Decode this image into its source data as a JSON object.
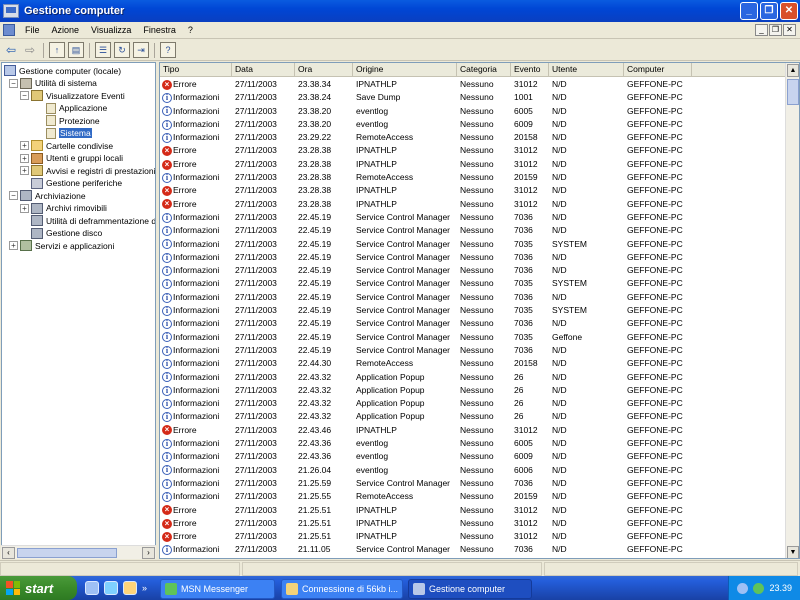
{
  "window": {
    "title": "Gestione computer",
    "controls": [
      "_",
      "❐",
      "✕"
    ]
  },
  "menu": {
    "items": [
      "File",
      "Azione",
      "Visualizza",
      "Finestra",
      "?"
    ],
    "mdi_controls": [
      "_",
      "❐",
      "✕"
    ]
  },
  "tree": {
    "nodes": [
      {
        "label": "Gestione computer (locale)",
        "level": 0,
        "expander": "",
        "icon": "computer-icon"
      },
      {
        "label": "Utilità di sistema",
        "level": 1,
        "expander": "−",
        "icon": "tools-icon"
      },
      {
        "label": "Visualizzatore Eventi",
        "level": 2,
        "expander": "−",
        "icon": "event-viewer-icon"
      },
      {
        "label": "Applicazione",
        "level": 3,
        "expander": "",
        "icon": "log-icon"
      },
      {
        "label": "Protezione",
        "level": 3,
        "expander": "",
        "icon": "log-icon"
      },
      {
        "label": "Sistema",
        "level": 3,
        "expander": "",
        "icon": "log-icon",
        "selected": true
      },
      {
        "label": "Cartelle condivise",
        "level": 2,
        "expander": "+",
        "icon": "folder-icon"
      },
      {
        "label": "Utenti e gruppi locali",
        "level": 2,
        "expander": "+",
        "icon": "users-icon"
      },
      {
        "label": "Avvisi e registri di prestazioni",
        "level": 2,
        "expander": "+",
        "icon": "performance-icon"
      },
      {
        "label": "Gestione periferiche",
        "level": 2,
        "expander": "",
        "icon": "device-icon"
      },
      {
        "label": "Archiviazione",
        "level": 1,
        "expander": "−",
        "icon": "storage-icon"
      },
      {
        "label": "Archivi rimovibili",
        "level": 2,
        "expander": "+",
        "icon": "removable-icon"
      },
      {
        "label": "Utilità di deframmentazione dischi",
        "level": 2,
        "expander": "",
        "icon": "defrag-icon"
      },
      {
        "label": "Gestione disco",
        "level": 2,
        "expander": "",
        "icon": "disk-icon"
      },
      {
        "label": "Servizi e applicazioni",
        "level": 1,
        "expander": "+",
        "icon": "services-icon"
      }
    ]
  },
  "table": {
    "columns": [
      "Tipo",
      "Data",
      "Ora",
      "Origine",
      "Categoria",
      "Evento",
      "Utente",
      "Computer"
    ],
    "rows": [
      [
        "Errore",
        "27/11/2003",
        "23.38.34",
        "IPNATHLP",
        "Nessuno",
        "31012",
        "N/D",
        "GEFFONE-PC"
      ],
      [
        "Informazioni",
        "27/11/2003",
        "23.38.24",
        "Save Dump",
        "Nessuno",
        "1001",
        "N/D",
        "GEFFONE-PC"
      ],
      [
        "Informazioni",
        "27/11/2003",
        "23.38.20",
        "eventlog",
        "Nessuno",
        "6005",
        "N/D",
        "GEFFONE-PC"
      ],
      [
        "Informazioni",
        "27/11/2003",
        "23.38.20",
        "eventlog",
        "Nessuno",
        "6009",
        "N/D",
        "GEFFONE-PC"
      ],
      [
        "Informazioni",
        "27/11/2003",
        "23.29.22",
        "RemoteAccess",
        "Nessuno",
        "20158",
        "N/D",
        "GEFFONE-PC"
      ],
      [
        "Errore",
        "27/11/2003",
        "23.28.38",
        "IPNATHLP",
        "Nessuno",
        "31012",
        "N/D",
        "GEFFONE-PC"
      ],
      [
        "Errore",
        "27/11/2003",
        "23.28.38",
        "IPNATHLP",
        "Nessuno",
        "31012",
        "N/D",
        "GEFFONE-PC"
      ],
      [
        "Informazioni",
        "27/11/2003",
        "23.28.38",
        "RemoteAccess",
        "Nessuno",
        "20159",
        "N/D",
        "GEFFONE-PC"
      ],
      [
        "Errore",
        "27/11/2003",
        "23.28.38",
        "IPNATHLP",
        "Nessuno",
        "31012",
        "N/D",
        "GEFFONE-PC"
      ],
      [
        "Errore",
        "27/11/2003",
        "23.28.38",
        "IPNATHLP",
        "Nessuno",
        "31012",
        "N/D",
        "GEFFONE-PC"
      ],
      [
        "Informazioni",
        "27/11/2003",
        "22.45.19",
        "Service Control Manager",
        "Nessuno",
        "7036",
        "N/D",
        "GEFFONE-PC"
      ],
      [
        "Informazioni",
        "27/11/2003",
        "22.45.19",
        "Service Control Manager",
        "Nessuno",
        "7036",
        "N/D",
        "GEFFONE-PC"
      ],
      [
        "Informazioni",
        "27/11/2003",
        "22.45.19",
        "Service Control Manager",
        "Nessuno",
        "7035",
        "SYSTEM",
        "GEFFONE-PC"
      ],
      [
        "Informazioni",
        "27/11/2003",
        "22.45.19",
        "Service Control Manager",
        "Nessuno",
        "7036",
        "N/D",
        "GEFFONE-PC"
      ],
      [
        "Informazioni",
        "27/11/2003",
        "22.45.19",
        "Service Control Manager",
        "Nessuno",
        "7036",
        "N/D",
        "GEFFONE-PC"
      ],
      [
        "Informazioni",
        "27/11/2003",
        "22.45.19",
        "Service Control Manager",
        "Nessuno",
        "7035",
        "SYSTEM",
        "GEFFONE-PC"
      ],
      [
        "Informazioni",
        "27/11/2003",
        "22.45.19",
        "Service Control Manager",
        "Nessuno",
        "7036",
        "N/D",
        "GEFFONE-PC"
      ],
      [
        "Informazioni",
        "27/11/2003",
        "22.45.19",
        "Service Control Manager",
        "Nessuno",
        "7035",
        "SYSTEM",
        "GEFFONE-PC"
      ],
      [
        "Informazioni",
        "27/11/2003",
        "22.45.19",
        "Service Control Manager",
        "Nessuno",
        "7036",
        "N/D",
        "GEFFONE-PC"
      ],
      [
        "Informazioni",
        "27/11/2003",
        "22.45.19",
        "Service Control Manager",
        "Nessuno",
        "7035",
        "Geffone",
        "GEFFONE-PC"
      ],
      [
        "Informazioni",
        "27/11/2003",
        "22.45.19",
        "Service Control Manager",
        "Nessuno",
        "7036",
        "N/D",
        "GEFFONE-PC"
      ],
      [
        "Informazioni",
        "27/11/2003",
        "22.44.30",
        "RemoteAccess",
        "Nessuno",
        "20158",
        "N/D",
        "GEFFONE-PC"
      ],
      [
        "Informazioni",
        "27/11/2003",
        "22.43.32",
        "Application Popup",
        "Nessuno",
        "26",
        "N/D",
        "GEFFONE-PC"
      ],
      [
        "Informazioni",
        "27/11/2003",
        "22.43.32",
        "Application Popup",
        "Nessuno",
        "26",
        "N/D",
        "GEFFONE-PC"
      ],
      [
        "Informazioni",
        "27/11/2003",
        "22.43.32",
        "Application Popup",
        "Nessuno",
        "26",
        "N/D",
        "GEFFONE-PC"
      ],
      [
        "Informazioni",
        "27/11/2003",
        "22.43.32",
        "Application Popup",
        "Nessuno",
        "26",
        "N/D",
        "GEFFONE-PC"
      ],
      [
        "Errore",
        "27/11/2003",
        "22.43.46",
        "IPNATHLP",
        "Nessuno",
        "31012",
        "N/D",
        "GEFFONE-PC"
      ],
      [
        "Informazioni",
        "27/11/2003",
        "22.43.36",
        "eventlog",
        "Nessuno",
        "6005",
        "N/D",
        "GEFFONE-PC"
      ],
      [
        "Informazioni",
        "27/11/2003",
        "22.43.36",
        "eventlog",
        "Nessuno",
        "6009",
        "N/D",
        "GEFFONE-PC"
      ],
      [
        "Informazioni",
        "27/11/2003",
        "21.26.04",
        "eventlog",
        "Nessuno",
        "6006",
        "N/D",
        "GEFFONE-PC"
      ],
      [
        "Informazioni",
        "27/11/2003",
        "21.25.59",
        "Service Control Manager",
        "Nessuno",
        "7036",
        "N/D",
        "GEFFONE-PC"
      ],
      [
        "Informazioni",
        "27/11/2003",
        "21.25.55",
        "RemoteAccess",
        "Nessuno",
        "20159",
        "N/D",
        "GEFFONE-PC"
      ],
      [
        "Errore",
        "27/11/2003",
        "21.25.51",
        "IPNATHLP",
        "Nessuno",
        "31012",
        "N/D",
        "GEFFONE-PC"
      ],
      [
        "Errore",
        "27/11/2003",
        "21.25.51",
        "IPNATHLP",
        "Nessuno",
        "31012",
        "N/D",
        "GEFFONE-PC"
      ],
      [
        "Errore",
        "27/11/2003",
        "21.25.51",
        "IPNATHLP",
        "Nessuno",
        "31012",
        "N/D",
        "GEFFONE-PC"
      ],
      [
        "Informazioni",
        "27/11/2003",
        "21.11.05",
        "Service Control Manager",
        "Nessuno",
        "7036",
        "N/D",
        "GEFFONE-PC"
      ]
    ]
  },
  "taskbar": {
    "start_label": "start",
    "quicklaunch_more": "»",
    "tasks": [
      {
        "label": "MSN Messenger",
        "active": false
      },
      {
        "label": "Connessione di 56kb i...",
        "active": false
      },
      {
        "label": "Gestione computer",
        "active": true
      }
    ],
    "clock": "23.39"
  },
  "colors": {
    "title_bar": "#0A5BE0",
    "selection": "#316AC5",
    "error_icon": "#d42a18",
    "start_button": "#3a8a2a",
    "taskbar": "#245edb"
  }
}
